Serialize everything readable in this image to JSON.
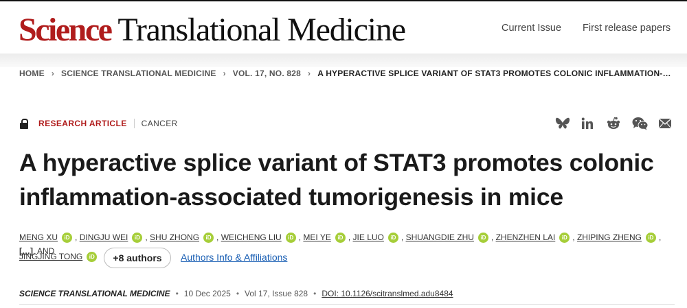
{
  "header": {
    "logo_science": "Science",
    "logo_rest": " Translational Medicine",
    "nav": [
      "Current Issue",
      "First release papers"
    ]
  },
  "breadcrumb": [
    "HOME",
    "SCIENCE TRANSLATIONAL MEDICINE",
    "VOL. 17, NO. 828",
    "A HYPERACTIVE SPLICE VARIANT OF STAT3 PROMOTES COLONIC INFLAMMATION-…"
  ],
  "article": {
    "type": "RESEARCH ARTICLE",
    "subject": "CANCER",
    "title": "A hyperactive splice variant of STAT3 promotes colonic inflammation-associated tumorigenesis in mice",
    "authors": [
      "MENG XU",
      "DINGJU WEI",
      "SHU ZHONG",
      "WEICHENG LIU",
      "MEI YE",
      "JIE LUO",
      "SHUANGDIE ZHU",
      "ZHENZHEN LAI",
      "ZHIPING ZHENG"
    ],
    "ellipsis": "[…]",
    "and_text": ", AND",
    "last_author": "JINGJING TONG",
    "orcid_label": "iD",
    "more_authors": "+8 authors",
    "affiliations_link": "Authors Info & Affiliations",
    "journal": "SCIENCE TRANSLATIONAL MEDICINE",
    "date": "10 Dec 2025",
    "volume": "Vol 17, Issue 828",
    "doi": "DOI: 10.1126/scitranslmed.adu8484"
  },
  "share_icons": [
    "bluesky-icon",
    "linkedin-icon",
    "reddit-icon",
    "wechat-icon",
    "email-icon"
  ],
  "colors": {
    "brand_red": "#b01c1c",
    "orcid_green": "#a6ce39",
    "link_blue": "#1a5fb4"
  }
}
